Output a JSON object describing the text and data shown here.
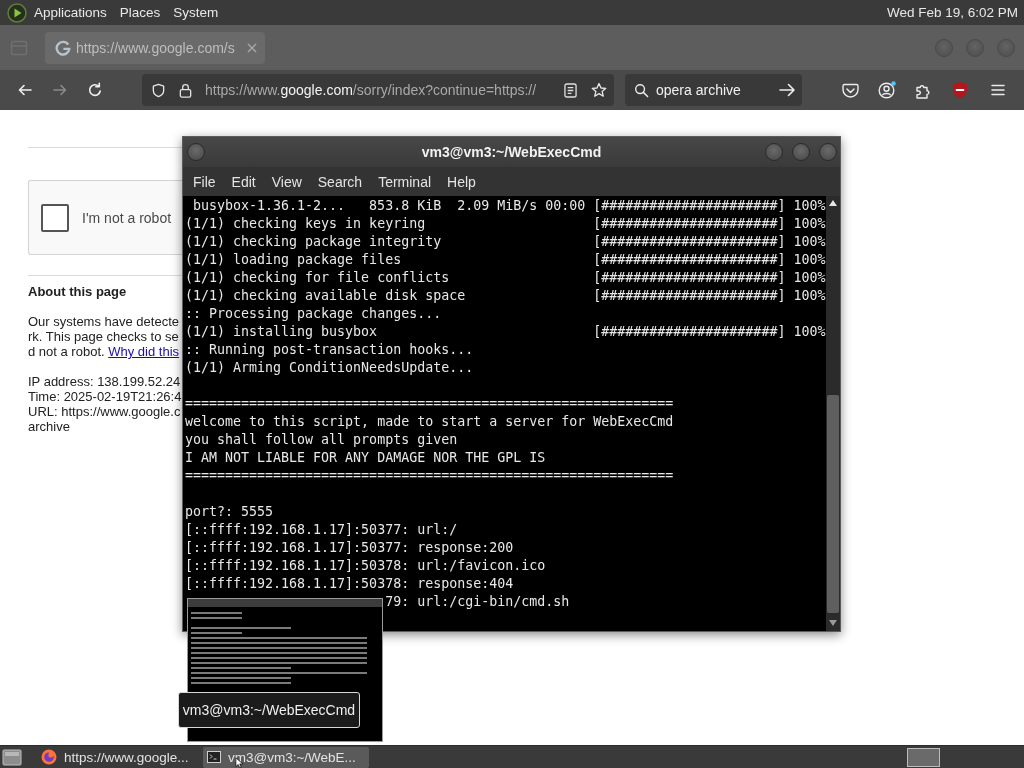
{
  "top_panel": {
    "menus": [
      "Applications",
      "Places",
      "System"
    ],
    "clock": "Wed Feb 19, 6:02 PM"
  },
  "browser": {
    "tabs": [
      {
        "title": "https://www.google.com/s",
        "selected": true
      }
    ],
    "nav_buttons": [
      {
        "kind": "back",
        "disabled": false
      },
      {
        "kind": "forward",
        "disabled": true
      },
      {
        "kind": "reload",
        "disabled": false
      }
    ],
    "address": {
      "before_domain": "https://www.",
      "domain": "google.com",
      "after_domain": "/sorry/index?continue=https://"
    },
    "search": {
      "value": "opera archive"
    },
    "page": {
      "captcha": {
        "label": "I'm not a robot",
        "checked": false
      },
      "heading": "About this page",
      "paragraph": {
        "lines": [
          "Our systems have detecte",
          "rk. This page checks to se",
          "d not a robot. "
        ],
        "link": "Why did this"
      },
      "details": [
        "IP address: 138.199.52.24",
        "Time: 2025-02-19T21:26:4",
        "URL: https://www.google.c",
        "archive"
      ]
    }
  },
  "terminal": {
    "title": "vm3@vm3:~/WebExecCmd",
    "menus": [
      "File",
      "Edit",
      "View",
      "Search",
      "Terminal",
      "Help"
    ],
    "blocks": [
      [
        {
          "text": " busybox-1.36.1-2...   853.8 KiB  2.09 MiB/s 00:00",
          "progress": "[######################] 100%"
        },
        {
          "text": "(1/1) checking keys in keyring",
          "progress": "[######################] 100%"
        },
        {
          "text": "(1/1) checking package integrity",
          "progress": "[######################] 100%"
        },
        {
          "text": "(1/1) loading package files",
          "progress": "[######################] 100%"
        },
        {
          "text": "(1/1) checking for file conflicts",
          "progress": "[######################] 100%"
        },
        {
          "text": "(1/1) checking available disk space",
          "progress": "[######################] 100%"
        },
        {
          "text": ":: Processing package changes..."
        },
        {
          "text": "(1/1) installing busybox",
          "progress": "[######################] 100%"
        },
        {
          "text": ":: Running post-transaction hooks..."
        },
        {
          "text": "(1/1) Arming ConditionNeedsUpdate..."
        }
      ],
      [
        {
          "text": "============================================================="
        },
        {
          "text": "welcome to this script, made to start a server for WebExecCmd"
        },
        {
          "text": "you shall follow all prompts given"
        },
        {
          "text": "I AM NOT LIABLE FOR ANY DAMAGE NOR THE GPL IS"
        },
        {
          "text": "============================================================="
        }
      ],
      [
        {
          "text": "port?: 5555"
        },
        {
          "text": "[::ffff:192.168.1.17]:50377: url:/"
        },
        {
          "text": "[::ffff:192.168.1.17]:50377: response:200"
        },
        {
          "text": "[::ffff:192.168.1.17]:50378: url:/favicon.ico"
        },
        {
          "text": "[::ffff:192.168.1.17]:50378: response:404"
        },
        {
          "text": "                         79: url:/cgi-bin/cmd.sh"
        }
      ]
    ]
  },
  "preview": {
    "tooltip": "vm3@vm3:~/WebExecCmd"
  },
  "taskbar": {
    "tasks": [
      {
        "kind": "browser",
        "label": "https://www.google...",
        "selected": false
      },
      {
        "kind": "terminal",
        "label": "vm3@vm3:~/WebE...",
        "selected": true
      }
    ]
  }
}
